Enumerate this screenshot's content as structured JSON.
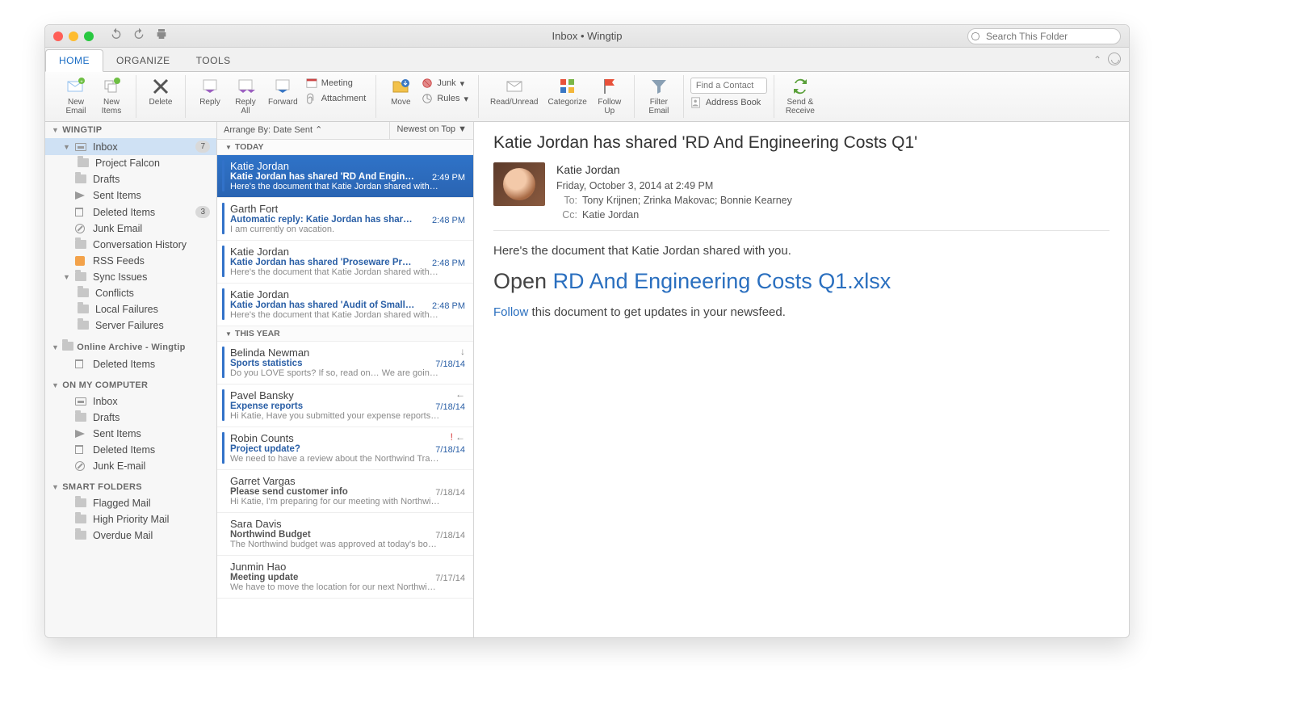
{
  "window": {
    "title": "Inbox • Wingtip",
    "search_placeholder": "Search This Folder"
  },
  "tabs": {
    "items": [
      "HOME",
      "ORGANIZE",
      "TOOLS"
    ],
    "active": 0
  },
  "ribbon": {
    "new_email": "New\nEmail",
    "new_items": "New\nItems",
    "delete": "Delete",
    "reply": "Reply",
    "reply_all": "Reply\nAll",
    "forward": "Forward",
    "meeting": "Meeting",
    "attachment": "Attachment",
    "move": "Move",
    "junk": "Junk",
    "rules": "Rules",
    "read_unread": "Read/Unread",
    "categorize": "Categorize",
    "follow_up": "Follow\nUp",
    "filter_email": "Filter\nEmail",
    "find_contact": "Find a Contact",
    "address_book": "Address Book",
    "send_receive": "Send &\nReceive"
  },
  "nav": {
    "account": "WINGTIP",
    "inbox": "Inbox",
    "inbox_count": "7",
    "project_falcon": "Project Falcon",
    "drafts": "Drafts",
    "sent": "Sent Items",
    "deleted": "Deleted Items",
    "deleted_count": "3",
    "junk": "Junk Email",
    "conv": "Conversation History",
    "rss": "RSS Feeds",
    "sync": "Sync Issues",
    "conflicts": "Conflicts",
    "local_fail": "Local Failures",
    "server_fail": "Server Failures",
    "archive": "Online Archive - Wingtip",
    "archive_deleted": "Deleted Items",
    "on_comp": "ON MY COMPUTER",
    "c_inbox": "Inbox",
    "c_drafts": "Drafts",
    "c_sent": "Sent Items",
    "c_deleted": "Deleted Items",
    "c_junk": "Junk E-mail",
    "smart": "SMART FOLDERS",
    "flagged": "Flagged Mail",
    "high": "High Priority Mail",
    "overdue": "Overdue Mail"
  },
  "arrange": {
    "by": "Arrange By: Date Sent  ⌃",
    "order": "Newest on Top  ▼"
  },
  "groups": {
    "today": "TODAY",
    "year": "THIS YEAR"
  },
  "messages": [
    {
      "from": "Katie Jordan",
      "subj": "Katie Jordan has shared 'RD And Engineeri…",
      "prev": "Here's the document that Katie Jordan shared with you…",
      "time": "2:49 PM",
      "sel": true
    },
    {
      "from": "Garth Fort",
      "subj": "Automatic reply: Katie Jordan has shared '…",
      "prev": "I am currently on vacation.",
      "time": "2:48 PM"
    },
    {
      "from": "Katie Jordan",
      "subj": "Katie Jordan has shared 'Proseware Projec…",
      "prev": "Here's the document that Katie Jordan shared with you…",
      "time": "2:48 PM"
    },
    {
      "from": "Katie Jordan",
      "subj": "Katie Jordan has shared 'Audit of Small Bu…",
      "prev": "Here's the document that Katie Jordan shared with you…",
      "time": "2:48 PM"
    }
  ],
  "messages_year": [
    {
      "from": "Belinda Newman",
      "subj": "Sports statistics",
      "prev": "Do you LOVE sports? If so, read on… We are going to…",
      "time": "7/18/14",
      "ind": "↓"
    },
    {
      "from": "Pavel Bansky",
      "subj": "Expense reports",
      "prev": "Hi Katie, Have you submitted your expense reports yet…",
      "time": "7/18/14",
      "ind": "←"
    },
    {
      "from": "Robin Counts",
      "subj": "Project update?",
      "prev": "We need to have a review about the Northwind Traders…",
      "time": "7/18/14",
      "ind": "! ←",
      "imp": true
    },
    {
      "from": "Garret Vargas",
      "subj": "Please send customer info",
      "prev": "Hi Katie, I'm preparing for our meeting with Northwind,…",
      "time": "7/18/14",
      "read": true
    },
    {
      "from": "Sara Davis",
      "subj": "Northwind Budget",
      "prev": "The Northwind budget was approved at today's board…",
      "time": "7/18/14",
      "read": true
    },
    {
      "from": "Junmin Hao",
      "subj": "Meeting update",
      "prev": "We have to move the location for our next Northwind Tr…",
      "time": "7/17/14",
      "read": true
    }
  ],
  "reading": {
    "subject": "Katie Jordan has shared 'RD And Engineering Costs Q1'",
    "from": "Katie Jordan",
    "date": "Friday, October 3, 2014 at 2:49 PM",
    "to_label": "To:",
    "to": "Tony Krijnen;   Zrinka Makovac;   Bonnie Kearney",
    "cc_label": "Cc:",
    "cc": "Katie Jordan",
    "line1": "Here's the document that Katie Jordan shared with you.",
    "open_prefix": "Open ",
    "open_link": "RD And Engineering Costs Q1.xlsx",
    "follow": "Follow",
    "follow_suffix": " this document to get updates in your newsfeed."
  }
}
